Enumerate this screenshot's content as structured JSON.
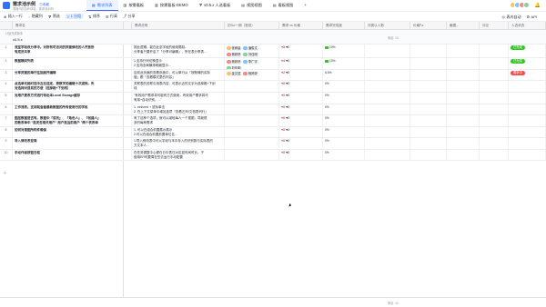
{
  "app": {
    "title": "需求池示例",
    "title_badge": "已收藏",
    "subtitle": "表格内的协作体验，需求池示例",
    "tabs": [
      {
        "icon": "grid-icon",
        "label": "需求列表",
        "active": true
      },
      {
        "icon": "kanban-icon",
        "label": "按需看板",
        "active": false
      },
      {
        "icon": "kanban-icon",
        "label": "按需看板-DEMO",
        "active": false
      },
      {
        "icon": "filter-icon",
        "label": "v0.5.x 人选看板",
        "active": false
      },
      {
        "icon": "gallery-icon",
        "label": "视图视图",
        "active": false
      },
      {
        "icon": "gallery-icon",
        "label": "看板视图",
        "active": false
      }
    ],
    "tab_add": "+",
    "avatar_colors": [
      "#f7c46c",
      "#7ac5ff",
      "#f08b8b",
      "#8bd19b"
    ]
  },
  "toolbar": {
    "items": [
      {
        "icon": "plus-icon",
        "label": "插入一行",
        "active": false
      },
      {
        "icon": "eye-off-icon",
        "label": "隐藏列",
        "active": false
      },
      {
        "icon": "filter-icon",
        "label": "筛选",
        "active": false
      },
      {
        "icon": "group-icon",
        "label": "1 分组",
        "active": true
      },
      {
        "icon": "sort-icon",
        "label": "排序",
        "active": false
      },
      {
        "icon": "row-height-icon",
        "label": "行高",
        "active": false
      },
      {
        "icon": "share-icon",
        "label": "分享",
        "active": false
      }
    ],
    "right": [
      {
        "icon": "robot-icon",
        "label": "表内自动"
      },
      {
        "icon": "api-icon",
        "label": "API"
      }
    ]
  },
  "columns": [
    {
      "label": "需求名"
    },
    {
      "label": "需求说明"
    },
    {
      "label": "初Go一期（首批）"
    },
    {
      "label": "需求 vs 价格"
    },
    {
      "label": "需求完成度"
    },
    {
      "label": "评委认人数"
    },
    {
      "label": "价格Fa"
    },
    {
      "label": "截图..."
    },
    {
      "label": "评论"
    },
    {
      "label": "人选状态"
    }
  ],
  "group": {
    "label": "计划完成版本",
    "value": "v0.5.x",
    "summary": "条目: 10"
  },
  "rows": [
    {
      "num": "1",
      "name": [
        "流至字段改分享中。对所有可访问的页面修改的人开放所",
        "有成员共享"
      ],
      "desc": [
        "按此逻辑，能在此至字段的使用限制。",
        "分享者只要开启了「分享可编辑」，所在表分享表..."
      ],
      "people": [
        {
          "name": "张雨晨",
          "color": "#f7c46c"
        },
        {
          "name": "潘俊文",
          "color": "#7ac5ff"
        },
        {
          "name": "杨婷婷",
          "color": "#f08b8b"
        },
        {
          "name": "刘佳明",
          "color": "#8bd19b"
        }
      ],
      "likes": "5",
      "dislikes": "0",
      "progress": "10%",
      "show_bar": true,
      "status": "已完成",
      "status_color": "#34c724"
    },
    {
      "num": "2",
      "name": [
        "数据横向列表"
      ],
      "desc": [
        "1.支持行列切换显示",
        "2.支持全局横排明细显示..."
      ],
      "people": [
        {
          "name": "杨婷婷",
          "color": "#f08b8b"
        },
        {
          "name": "李广宇",
          "color": "#7ac5ff"
        },
        {
          "name": "刘佳明",
          "color": "#8bd19b"
        }
      ],
      "likes": "4",
      "dislikes": "0",
      "progress": "10%",
      "show_bar": true,
      "status": "已完成",
      "status_color": "#34c724"
    },
    {
      "num": "3",
      "name": [
        "分享页面的单行往回展开编辑"
      ],
      "desc": [
        "目前此页面的查看页面中，可以单行从「按默情的实际",
        "值」跟「查看模式里的内容」"
      ],
      "people": [
        {
          "name": "金文斌",
          "color": "#f7c46c"
        },
        {
          "name": "杨婷婷",
          "color": "#f08b8b"
        }
      ],
      "likes": "2",
      "dislikes": "0",
      "progress": "6.6%",
      "show_bar": false,
      "status": "需求中",
      "status_color": "#f54a45"
    },
    {
      "num": "4",
      "name": [
        "点选单元格时选中左右选定，按数字的编辑十次或样。失",
        "对选择对目前的方便（选择格+下划线）"
      ],
      "desc": [
        "关联表的关联引用表内容，可表示近的文字为选择格+下划",
        "线"
      ],
      "people": [],
      "likes": "0",
      "dislikes": "0",
      "progress": "0%",
      "show_bar": false,
      "status": "",
      "status_color": ""
    },
    {
      "num": "5",
      "name": [
        "对用户要表方式进行导出本Local Storage缓存"
      ],
      "desc": [
        "\"有效用户需求将可能有方式使用，有效用户需求将可",
        "有用+自动识别。...\""
      ],
      "people": [],
      "likes": "0",
      "dislikes": "0",
      "progress": "0%",
      "show_bar": false,
      "status": "",
      "status_color": ""
    },
    {
      "num": "6",
      "name": [
        "工作流表。支持就查看最新数据的所有使用行的字段"
      ],
      "desc": [
        "1. ctrl/cmd + 鼠标单击",
        "2. 在上下文菜单中增加选项『查看左列/文档表列行』"
      ],
      "people": [],
      "likes": "0",
      "dislikes": "0",
      "progress": "0%",
      "show_bar": false,
      "status": "",
      "status_color": ""
    },
    {
      "num": "7",
      "name": [
        "图层数据是否有。数据中『成员』、『角色人』、『创建人』",
        "的数表单中 \"是发去相关用户\" 用户是当前用户 \"两个表表单"
      ],
      "desc": [
        "有了这种个选项，就可以减轻每人一个视图，导致很",
        "多的每种需求"
      ],
      "people": [],
      "likes": "0",
      "dislikes": "0",
      "progress": "0%",
      "show_bar": false,
      "status": "",
      "status_color": ""
    },
    {
      "num": "8",
      "name": [
        "如何对视图所构件确保"
      ],
      "desc": [
        "1. 可以在组合前置展示展示",
        "2.可以在组合前置前置单位名..."
      ],
      "people": [],
      "likes": "0",
      "dislikes": "0",
      "progress": "0%",
      "show_bar": false,
      "status": "",
      "status_color": ""
    },
    {
      "num": "9",
      "name": [
        "导入修改表变库"
      ],
      "desc": [
        "1.导入修改表中可以字经与本中存入的识别数与实际表的",
        "方文本人..."
      ],
      "people": [],
      "likes": "0",
      "dislikes": "0",
      "progress": "0%",
      "show_bar": false,
      "status": "",
      "status_color": ""
    },
    {
      "num": "10",
      "name": [
        "手动作者按钮日程"
      ],
      "desc": [
        "在任务调整中心便在日中表日对定如时间时长。子",
        "使用ER时要周在些去运行手动配置"
      ],
      "people": [],
      "likes": "0",
      "dislikes": "0",
      "progress": "0%",
      "show_bar": false,
      "status": "",
      "status_color": ""
    }
  ],
  "add_row": "+",
  "footer": {
    "summary": "条目: 10"
  }
}
